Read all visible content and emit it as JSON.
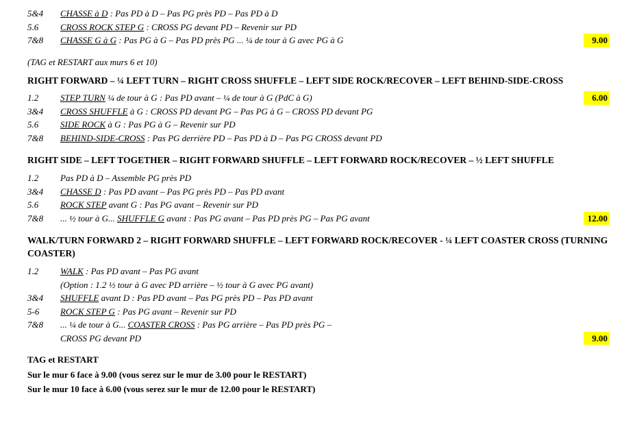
{
  "intro_lines": [
    {
      "count": "5&4",
      "desc": "CHASSE à D : Pas PD à D – Pas PG près PD – Pas PD à D",
      "score": null
    },
    {
      "count": "5.6",
      "desc": "CROSS ROCK STEP G : CROSS PG devant PD – Revenir sur PD",
      "score": null
    },
    {
      "count": "7&8",
      "desc": "CHASSE G à G : Pas PG à G – Pas PD près PG  ... ¼ de tour à G avec PG à G",
      "score": "9.00"
    }
  ],
  "tag_note": "(TAG et RESTART aux murs 6 et 10)",
  "sections": [
    {
      "header": "RIGHT FORWARD – ¼ LEFT TURN – RIGHT CROSS SHUFFLE – LEFT SIDE ROCK/RECOVER – LEFT BEHIND-SIDE-CROSS",
      "lines": [
        {
          "count": "1.2",
          "key": "STEP TURN",
          "desc": "¼ de tour à G : Pas PD avant – ¼ de tour à G (PdC à G)",
          "score": "6.00"
        },
        {
          "count": "3&4",
          "key": "CROSS SHUFFLE",
          "suffix": " à G : CROSS PD devant PG – Pas PG à G – CROSS PD devant PG",
          "score": null
        },
        {
          "count": "5.6",
          "key": "SIDE ROCK",
          "suffix": " à G :  Pas PG à G – Revenir sur PD",
          "score": null
        },
        {
          "count": "7&8",
          "key": "BEHIND-SIDE-CROSS",
          "suffix": " : Pas PG derrière PD – Pas PD à D – Pas PG CROSS devant PD",
          "score": null
        }
      ]
    },
    {
      "header": "RIGHT SIDE – LEFT TOGETHER – RIGHT FORWARD SHUFFLE – LEFT FORWARD ROCK/RECOVER – ½ LEFT SHUFFLE",
      "lines": [
        {
          "count": "1.2",
          "key": null,
          "desc": "Pas PD à D – Assemble PG près PD",
          "score": null
        },
        {
          "count": "3&4",
          "key": "CHASSE D",
          "suffix": " : Pas PD avant – Pas PG près PD – Pas PD avant",
          "score": null
        },
        {
          "count": "5.6",
          "key": "ROCK STEP",
          "suffix": " avant G : Pas PG avant – Revenir sur PD",
          "score": null
        },
        {
          "count": "7&8",
          "key": null,
          "desc": "... ½ tour à G...  SHUFFLE G avant : Pas PG avant – Pas PD près PG – Pas PG avant",
          "score": "12.00"
        }
      ]
    },
    {
      "header": "WALK/TURN FORWARD 2 – RIGHT FORWARD SHUFFLE – LEFT FORWARD ROCK/RECOVER - ¼ LEFT COASTER CROSS (TURNING COASTER)",
      "lines": [
        {
          "count": "1.2",
          "key": "WALK",
          "suffix": " : Pas PD avant – Pas PG avant",
          "score": null
        },
        {
          "count": null,
          "option": "(Option : 1.2  ½ tour à G avec PD arrière – ½ tour à G avec PG avant)",
          "score": null
        },
        {
          "count": "3&4",
          "key": "SHUFFLE",
          "suffix": " avant D : Pas PD avant – Pas PG près PD – Pas PD avant",
          "score": null
        },
        {
          "count": "5-6",
          "key": "ROCK STEP G",
          "suffix": " : Pas PG avant – Revenir sur PD",
          "score": null
        },
        {
          "count": "7&8",
          "key": null,
          "desc": "... ¼ de tour à G...  COASTER CROSS :  Pas PG arrière – Pas PD près PG –",
          "score": null
        },
        {
          "count": null,
          "continuation": "CROSS PG devant PD",
          "score": "9.00"
        }
      ]
    }
  ],
  "footer": {
    "tag_restart_label": "TAG et RESTART",
    "wall_lines": [
      "Sur le mur  6 face à 9.00 (vous serez sur le mur de  3.00 pour le RESTART)",
      "Sur le mur 10 face à 6.00 (vous serez sur le mur de 12.00 pour le RESTART)"
    ]
  }
}
